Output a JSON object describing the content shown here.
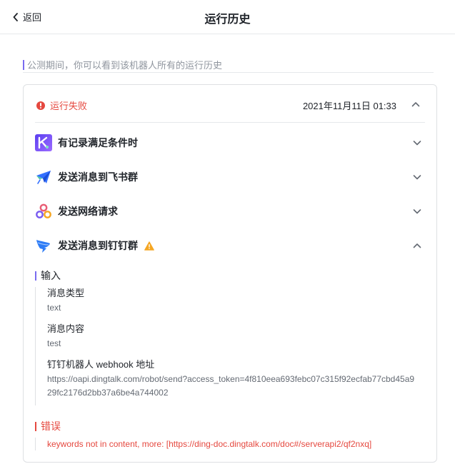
{
  "header": {
    "back_label": "返回",
    "title": "运行历史"
  },
  "notice": {
    "text": "公测期间，你可以看到该机器人所有的运行历史"
  },
  "run": {
    "status": "运行失败",
    "time": "2021年11月11日 01:33",
    "steps": [
      {
        "label": "有记录满足条件时",
        "icon": "trigger-record-icon"
      },
      {
        "label": "发送消息到飞书群",
        "icon": "feishu-send-icon"
      },
      {
        "label": "发送网络请求",
        "icon": "webhook-icon"
      },
      {
        "label": "发送消息到钉钉群",
        "icon": "dingtalk-icon",
        "warning": true
      }
    ],
    "input": {
      "title": "输入",
      "fields": [
        {
          "key": "消息类型",
          "value": "text"
        },
        {
          "key": "消息内容",
          "value": "test"
        },
        {
          "key": "钉钉机器人 webhook 地址",
          "value": "https://oapi.dingtalk.com/robot/send?access_token=4f810eea693febc07c315f92ecfab77cbd45a929fc2176d2bb37a6be4a744002"
        }
      ]
    },
    "error": {
      "title": "错误",
      "message": "keywords not in content, more: [https://ding-doc.dingtalk.com/doc#/serverapi2/qf2nxq]"
    }
  },
  "colors": {
    "accent": "#7a6cf0",
    "error": "#e5483f",
    "warning": "#f5a623"
  }
}
